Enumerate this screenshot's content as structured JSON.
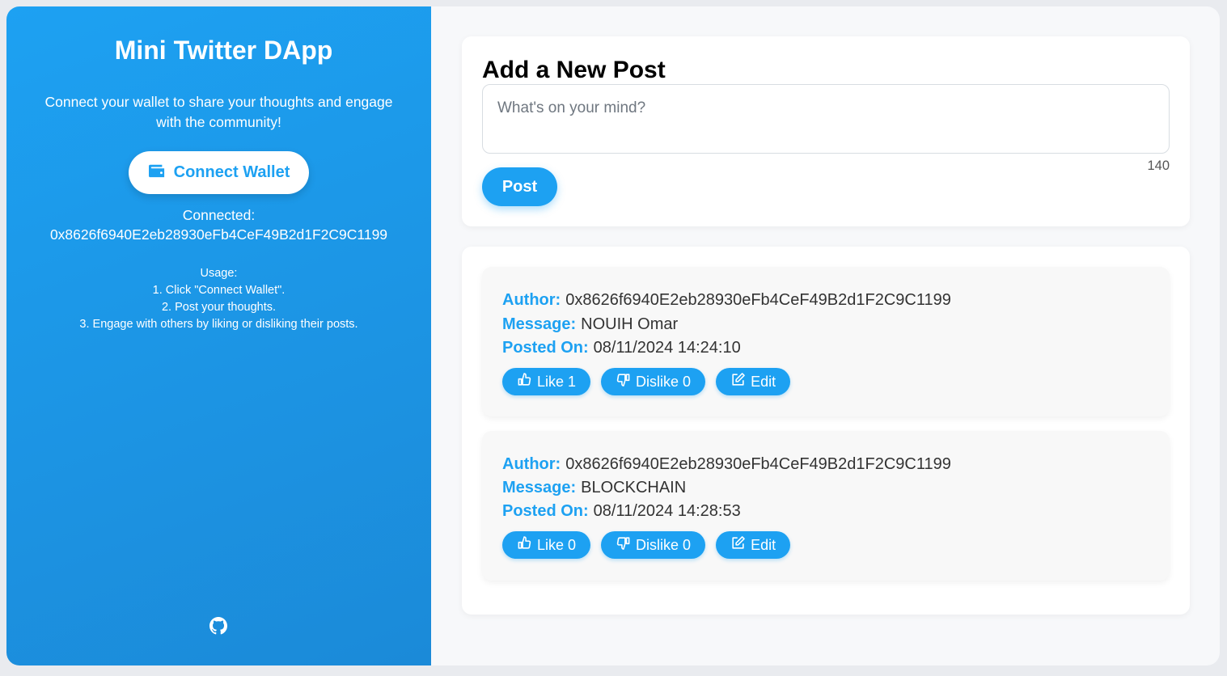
{
  "sidebar": {
    "title": "Mini Twitter DApp",
    "intro": "Connect your wallet to share your thoughts and engage with the community!",
    "connect_button": "Connect Wallet",
    "connected_label": "Connected:",
    "connected_address": "0x8626f6940E2eb28930eFb4CeF49B2d1F2C9C1199",
    "usage_title": "Usage:",
    "usage_steps": [
      "1. Click \"Connect Wallet\".",
      "2. Post your thoughts.",
      "3. Engage with others by liking or disliking their posts."
    ],
    "github_icon": "github-icon"
  },
  "new_post": {
    "heading": "Add a New Post",
    "placeholder": "What's on your mind?",
    "value": "",
    "char_counter": "140",
    "post_button": "Post"
  },
  "feed": {
    "labels": {
      "author": "Author:",
      "message": "Message:",
      "posted_on": "Posted On:"
    },
    "posts": [
      {
        "author": "0x8626f6940E2eb28930eFb4CeF49B2d1F2C9C1199",
        "message": "NOUIH Omar",
        "posted_on": "08/11/2024 14:24:10",
        "like_label": "Like 1",
        "dislike_label": "Dislike 0",
        "edit_label": "Edit"
      },
      {
        "author": "0x8626f6940E2eb28930eFb4CeF49B2d1F2C9C1199",
        "message": "BLOCKCHAIN",
        "posted_on": "08/11/2024 14:28:53",
        "like_label": "Like 0",
        "dislike_label": "Dislike 0",
        "edit_label": "Edit"
      }
    ]
  },
  "colors": {
    "accent": "#1da1f2",
    "sidebar_start": "#1da1f2",
    "sidebar_end": "#1b8ad8"
  }
}
